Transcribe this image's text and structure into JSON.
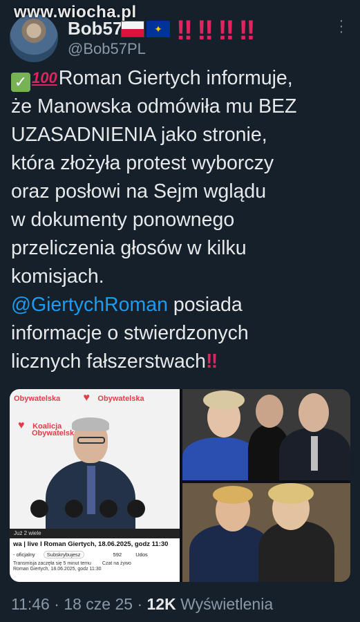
{
  "watermark": "www.wiocha.pl",
  "author": {
    "display_name": "Bob57",
    "handle": "@Bob57PL",
    "flags": [
      "flag-poland-icon",
      "flag-eu-icon"
    ],
    "alarm_marks": "‼‼‼‼"
  },
  "tweet": {
    "lines": [
      "Roman Giertych informuje,",
      "że Manowska odmówiła mu BEZ",
      "UZASADNIENIA jako stronie,",
      "która złożyła protest wyborczy",
      "oraz posłowi na Sejm wglądu",
      "w dokumenty ponownego",
      "przeliczenia głosów w kilku",
      "komisjach."
    ],
    "mention": "@GiertychRoman",
    "after_mention": " posiada",
    "line_10": "informacje o stwierdzonych",
    "line_11": "licznych fałszerstwach",
    "trailing_mark": "‼"
  },
  "media": {
    "left_panel": {
      "logo_line1": "Koalicja",
      "logo_line2": "Obywatelska",
      "video_time": "Już 2 wiele",
      "video_title": "wa | live I Roman Giertych, 18.06.2025, godz 11:30",
      "channel": "- oficjalny",
      "subscribe": "Subskrybujesz",
      "likes": "592",
      "share": "Udos",
      "desc1": "Transmisja zaczęła się 5 minut temu",
      "desc2": "Roman Giertych, 18.06.2025, godz 11:30",
      "live_chat": "Czat na żywo"
    }
  },
  "meta": {
    "time": "11:46",
    "date": "18 cze 25",
    "views_count": "12K",
    "views_label": "Wyświetlenia"
  },
  "colors": {
    "background": "#15202b",
    "text": "#e7e9ea",
    "secondary": "#8b98a5",
    "link": "#1d9bf0",
    "alarm": "#e0245e"
  }
}
